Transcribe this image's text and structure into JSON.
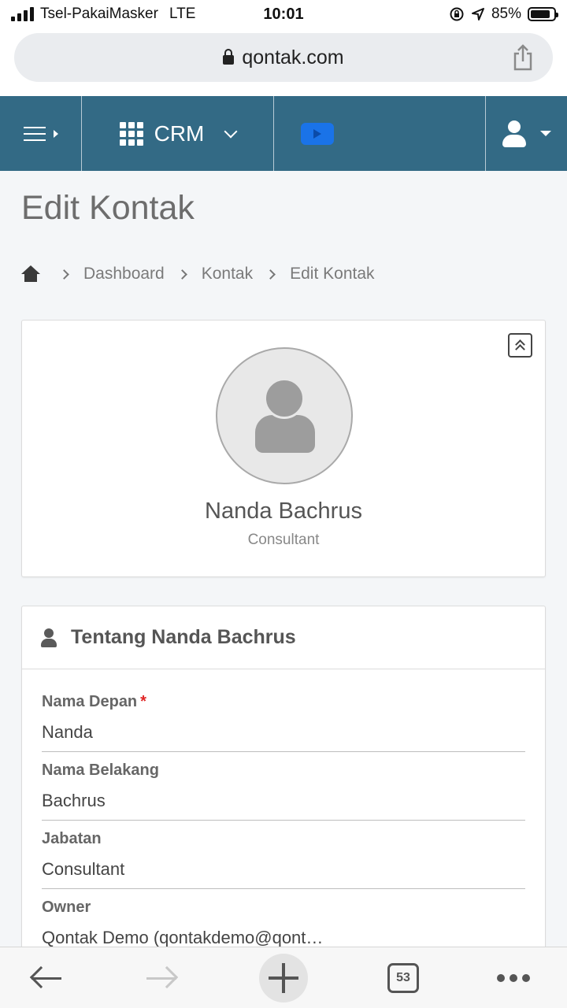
{
  "status_bar": {
    "carrier": "Tsel-PakaiMasker",
    "network": "LTE",
    "time": "10:01",
    "battery": "85%",
    "battery_level": 0.85
  },
  "browser": {
    "url": "qontak.com",
    "tab_count": "53"
  },
  "nav": {
    "app_label": "CRM"
  },
  "page": {
    "title": "Edit Kontak",
    "breadcrumb": [
      "Dashboard",
      "Kontak",
      "Edit Kontak"
    ]
  },
  "profile": {
    "name": "Nanda Bachrus",
    "role": "Consultant"
  },
  "about": {
    "title": "Tentang Nanda Bachrus",
    "required_mark": "*",
    "fields": [
      {
        "label": "Nama Depan",
        "value": "Nanda",
        "required": true
      },
      {
        "label": "Nama Belakang",
        "value": "Bachrus",
        "required": false
      },
      {
        "label": "Jabatan",
        "value": "Consultant",
        "required": false
      },
      {
        "label": "Owner",
        "value": "Qontak Demo (qontakdemo@qont…",
        "required": false
      }
    ]
  },
  "colors": {
    "nav_bg": "#336a85",
    "video_button": "#1a73e8",
    "required": "#e02424"
  }
}
